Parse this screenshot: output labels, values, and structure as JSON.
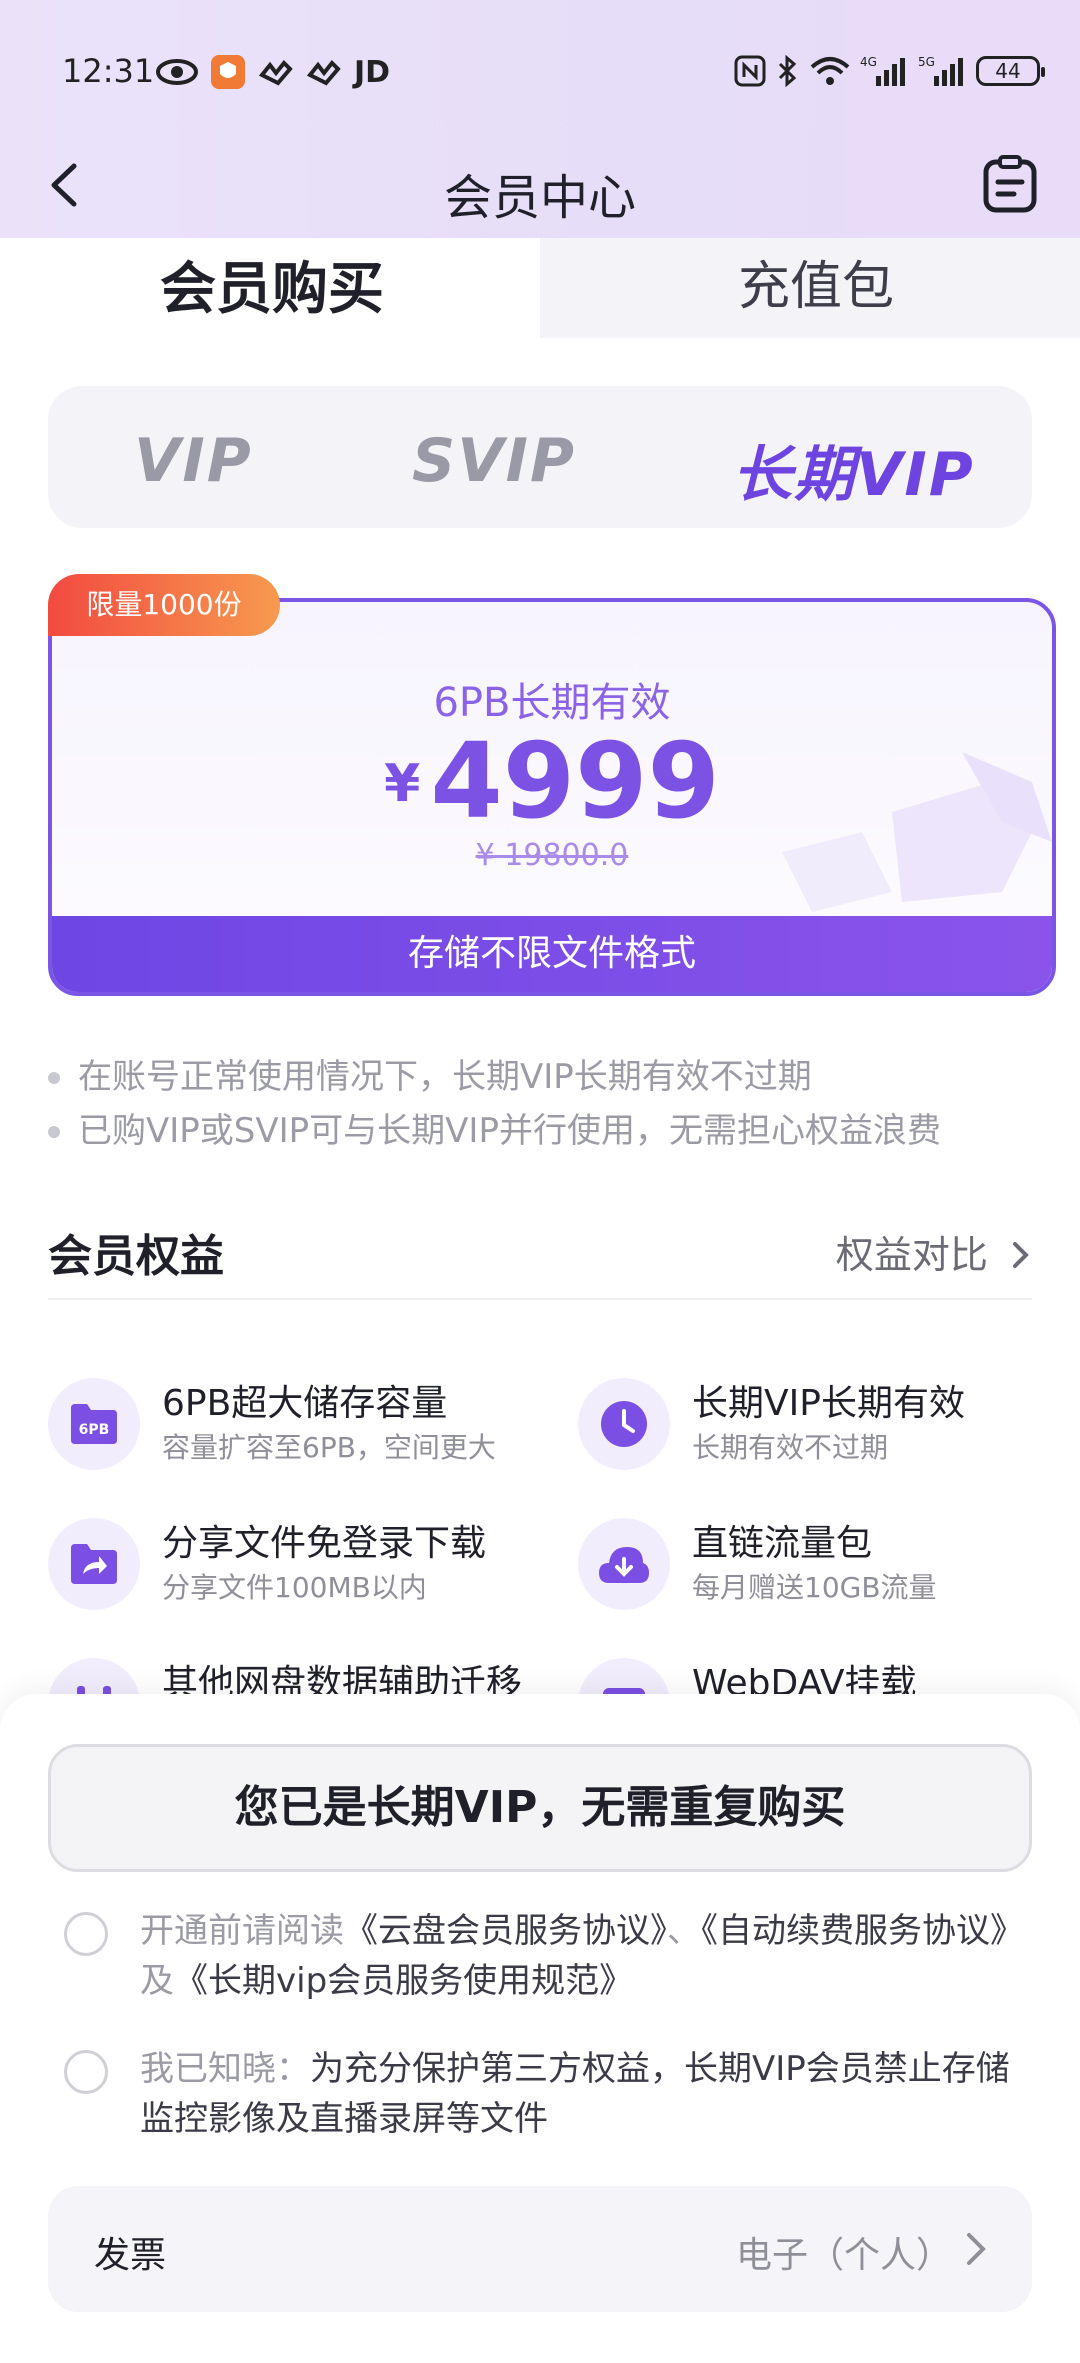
{
  "status_bar": {
    "time": "12:31",
    "left_icons": [
      "eye-icon",
      "app-shield-icon",
      "hand-icon",
      "hand-icon",
      "jd-icon"
    ],
    "jd_label": "JD",
    "right_icons": [
      "nfc-icon",
      "bluetooth-icon",
      "wifi-icon",
      "signal-4g-icon",
      "signal-5g-icon"
    ],
    "battery": "44"
  },
  "header": {
    "title": "会员中心",
    "back_icon": "chevron-left-icon",
    "right_icon": "clipboard-icon"
  },
  "purchase_tabs": {
    "active": "会员购买",
    "inactive": "充值包"
  },
  "vip_types": [
    "VIP",
    "SVIP",
    "长期VIP"
  ],
  "selected_vip": "长期VIP",
  "product": {
    "badge": "限量1000份",
    "name": "6PB长期有效",
    "currency": "¥",
    "price": "4999",
    "original_price": "¥ 19800.0",
    "footer": "存储不限文件格式",
    "accent": "#7a55e6"
  },
  "notes": [
    "在账号正常使用情况下，长期VIP长期有效不过期",
    "已购VIP或SVIP可与长期VIP并行使用，无需担心权益浪费"
  ],
  "benefits_section": {
    "title": "会员权益",
    "compare": "权益对比",
    "items": [
      {
        "title": "6PB超大储存容量",
        "subtitle": "容量扩容至6PB，空间更大",
        "icon": "storage-6pb-icon",
        "icon_text": "6PB"
      },
      {
        "title": "长期VIP长期有效",
        "subtitle": "长期有效不过期",
        "icon": "clock-icon"
      },
      {
        "title": "分享文件免登录下载",
        "subtitle": "分享文件100MB以内",
        "icon": "share-folder-icon"
      },
      {
        "title": "直链流量包",
        "subtitle": "每月赠送10GB流量",
        "icon": "cloud-download-icon"
      },
      {
        "title": "其他网盘数据辅助迁移",
        "subtitle": "",
        "icon": "migrate-icon"
      },
      {
        "title": "WebDAV挂载",
        "subtitle": "",
        "icon": "webdav-icon"
      }
    ]
  },
  "bottom": {
    "already_button": "您已是长期VIP，无需重复购买",
    "agreement1": {
      "prefix": "开通前请阅读",
      "link1": "《云盘会员服务协议》",
      "sep": "、",
      "link2": "《自动续费服务协议》",
      "and": "及",
      "link3": "《长期vip会员服务使用规范》"
    },
    "agreement2": {
      "prefix": "我已知晓：",
      "text": "为充分保护第三方权益，长期VIP会员禁止存储监控影像及直播录屏等文件"
    },
    "invoice": {
      "label": "发票",
      "value": "电子（个人）"
    }
  }
}
